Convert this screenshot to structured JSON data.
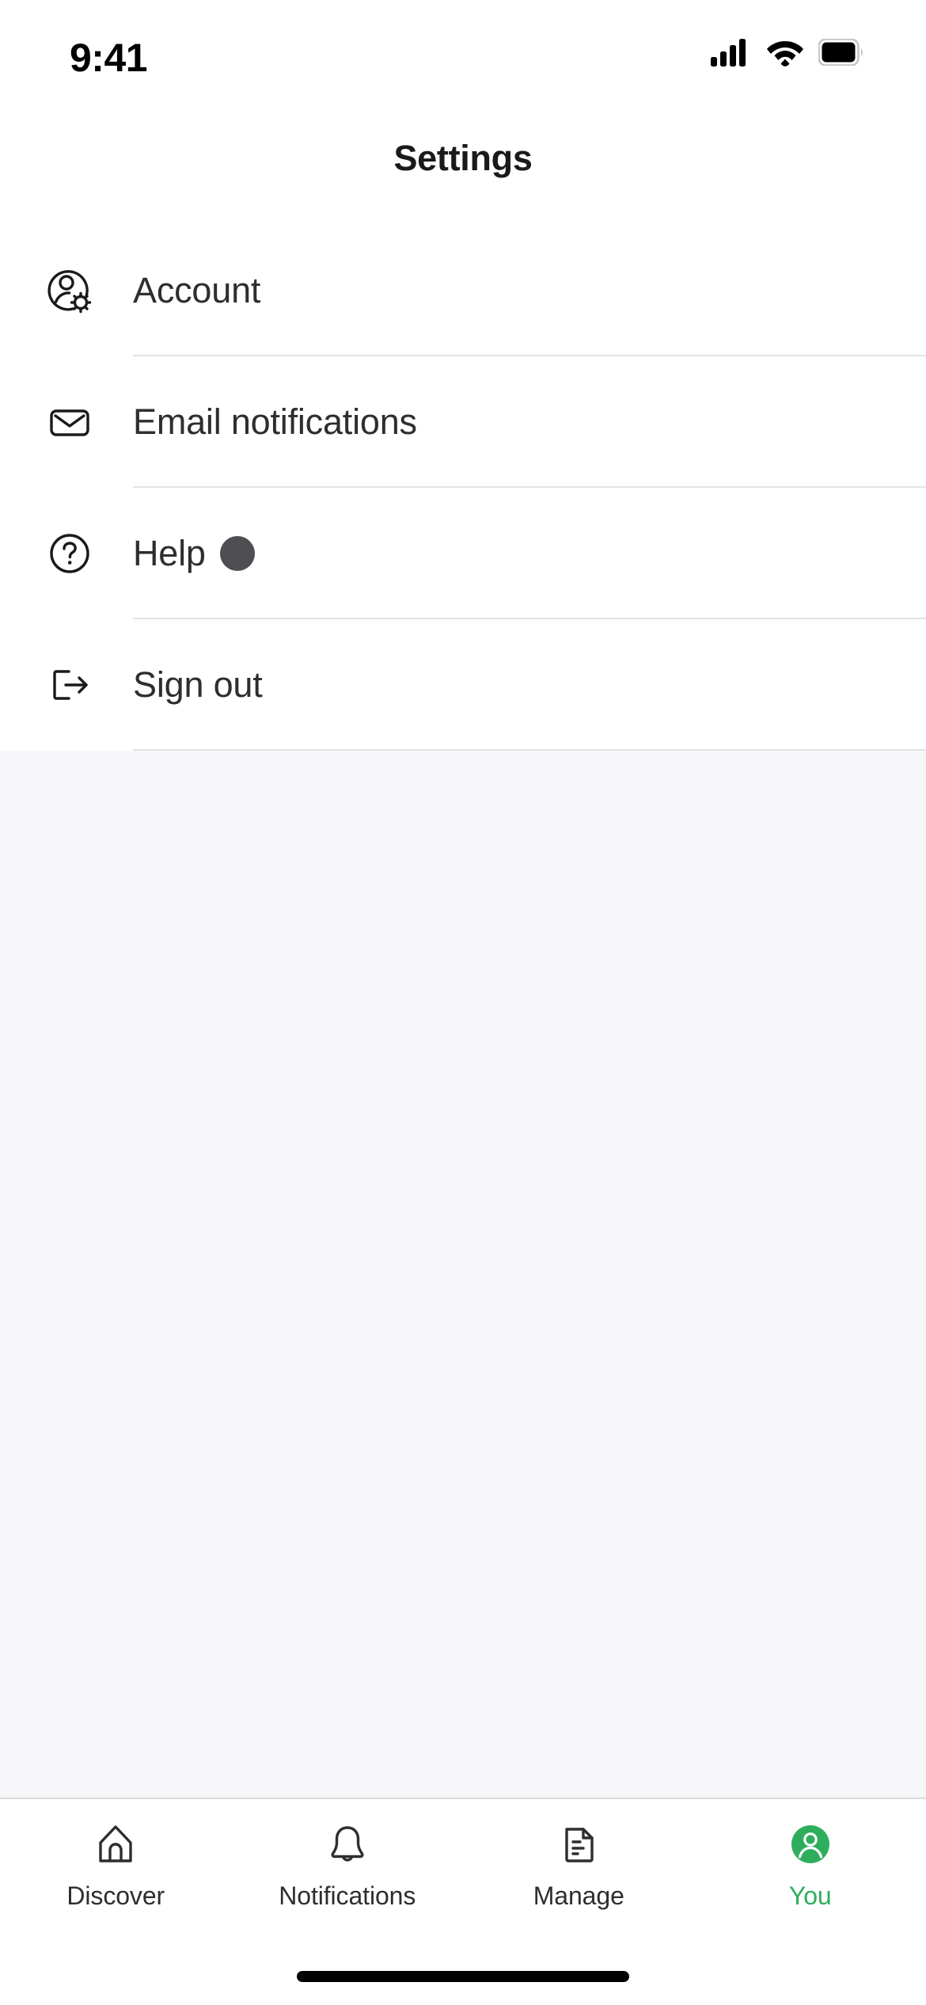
{
  "status_bar": {
    "time": "9:41",
    "cellular_icon": "cellular-signal-icon",
    "wifi_icon": "wifi-icon",
    "battery_icon": "battery-full-icon"
  },
  "header": {
    "title": "Settings"
  },
  "settings": {
    "items": [
      {
        "label": "Account",
        "icon": "account-gear-icon",
        "badge": false
      },
      {
        "label": "Email notifications",
        "icon": "envelope-icon",
        "badge": false
      },
      {
        "label": "Help",
        "icon": "question-circle-icon",
        "badge": true,
        "badge_color": "#4F4F53"
      },
      {
        "label": "Sign out",
        "icon": "sign-out-icon",
        "badge": false
      }
    ]
  },
  "tab_bar": {
    "active_color": "#2EAE5C",
    "inactive_color": "#2E2E30",
    "tabs": [
      {
        "label": "Discover",
        "icon": "home-icon",
        "active": false
      },
      {
        "label": "Notifications",
        "icon": "bell-icon",
        "active": false
      },
      {
        "label": "Manage",
        "icon": "document-icon",
        "active": false
      },
      {
        "label": "You",
        "icon": "avatar-person-icon",
        "active": true
      }
    ]
  },
  "colors": {
    "background": "#F7F6F8",
    "surface": "#FFFFFF",
    "divider": "#E3E3E6",
    "text_primary": "#2E2E30",
    "accent_green": "#2EAE5C"
  }
}
